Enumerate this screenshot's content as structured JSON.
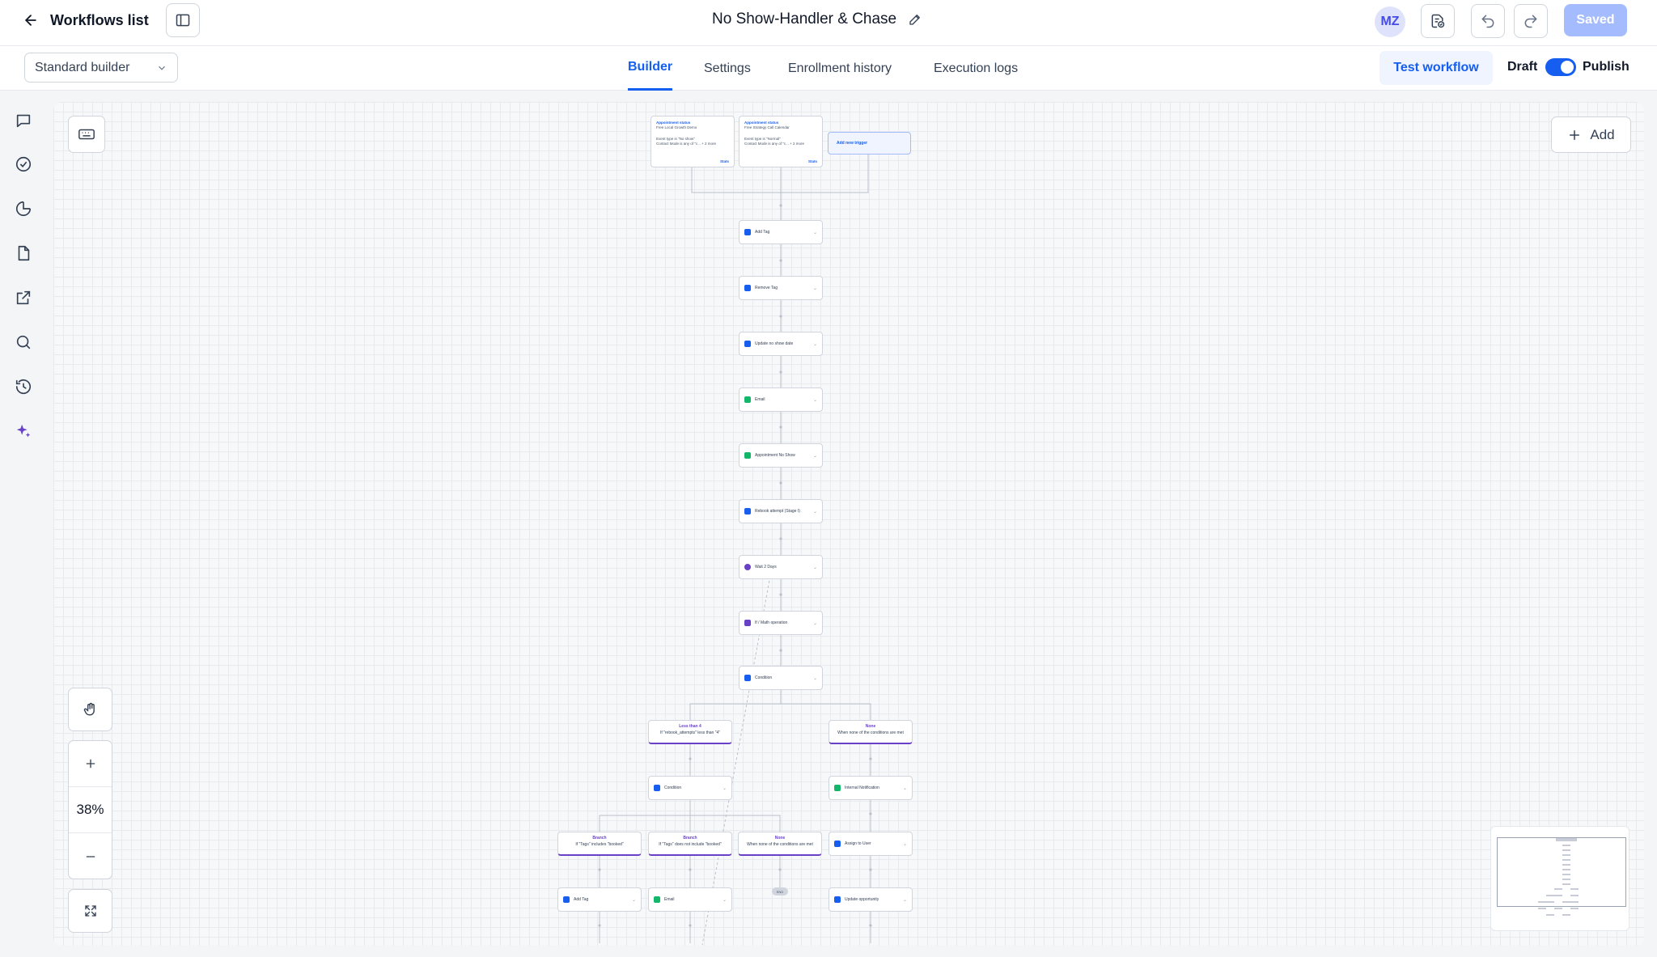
{
  "header": {
    "back_label": "Workflows list",
    "workflow_title": "No Show-Handler & Chase",
    "avatar_initials": "MZ",
    "saved_label": "Saved"
  },
  "tabbar": {
    "builder_mode": "Standard builder",
    "tabs": [
      {
        "label": "Builder",
        "active": true
      },
      {
        "label": "Settings",
        "active": false
      },
      {
        "label": "Enrollment history",
        "active": false
      },
      {
        "label": "Execution logs",
        "active": false
      }
    ],
    "test_label": "Test workflow",
    "draft_label": "Draft",
    "publish_label": "Publish",
    "publish_on": true
  },
  "rail": {
    "icons": [
      "chat-icon",
      "check-circle-icon",
      "pie-chart-icon",
      "document-icon",
      "external-link-icon",
      "search-icon",
      "history-icon",
      "sparkle-icon"
    ]
  },
  "canvas": {
    "add_label": "Add",
    "zoom_level": "38%",
    "triggers": [
      {
        "title": "Appointment status",
        "subtitle": "Free Local Growth Demo",
        "line1": "Event type is \"No show\"",
        "line2": "Contact Mode is any of \"c... + 2 more",
        "stats": "Stats"
      },
      {
        "title": "Appointment status",
        "subtitle": "Free Strategy Call Calendar",
        "line1": "Event type is \"Normal\"",
        "line2": "Contact Mode is any of \"c... + 2 more",
        "stats": "Stats"
      }
    ],
    "add_trigger_label": "Add new trigger",
    "actions": [
      {
        "label": "Add Tag",
        "color": "#155eef"
      },
      {
        "label": "Remove Tag",
        "color": "#155eef"
      },
      {
        "label": "Update no show date",
        "color": "#155eef"
      },
      {
        "label": "Email",
        "color": "#12b76a"
      },
      {
        "label": "Appointment No Show",
        "color": "#12b76a"
      },
      {
        "label": "Rebook attempt (Stage I)",
        "color": "#155eef"
      },
      {
        "label": "Wait 2 Days",
        "color": "#6941c6"
      },
      {
        "label": "If / Math operation",
        "color": "#6941c6"
      },
      {
        "label": "Condition",
        "color": "#155eef"
      }
    ],
    "branches_top": [
      {
        "name": "Less than 4",
        "desc": "If \"rebook_attempts\" less than \"4\""
      },
      {
        "name": "None",
        "desc": "When none of the conditions are met"
      }
    ],
    "left_condition": "Condition",
    "branches_bottom": [
      {
        "name": "Branch",
        "desc": "If \"Tags\" includes \"booked\""
      },
      {
        "name": "Branch",
        "desc": "If \"Tags\" does not include \"booked\""
      },
      {
        "name": "None",
        "desc": "When none of the conditions are met"
      }
    ],
    "right_nodes": [
      {
        "label": "Internal Notification",
        "color": "#12b76a"
      },
      {
        "label": "Assign to User",
        "color": "#155eef"
      },
      {
        "label": "Update opportunity",
        "color": "#155eef"
      }
    ],
    "bottom_nodes": [
      {
        "label": "Add Tag",
        "color": "#155eef"
      },
      {
        "label": "Email",
        "color": "#12b76a"
      }
    ],
    "end_pill": "END"
  },
  "colors": {
    "accent": "#155eef",
    "branch": "#6941c6",
    "saved_disabled": "#a4bcfd"
  }
}
